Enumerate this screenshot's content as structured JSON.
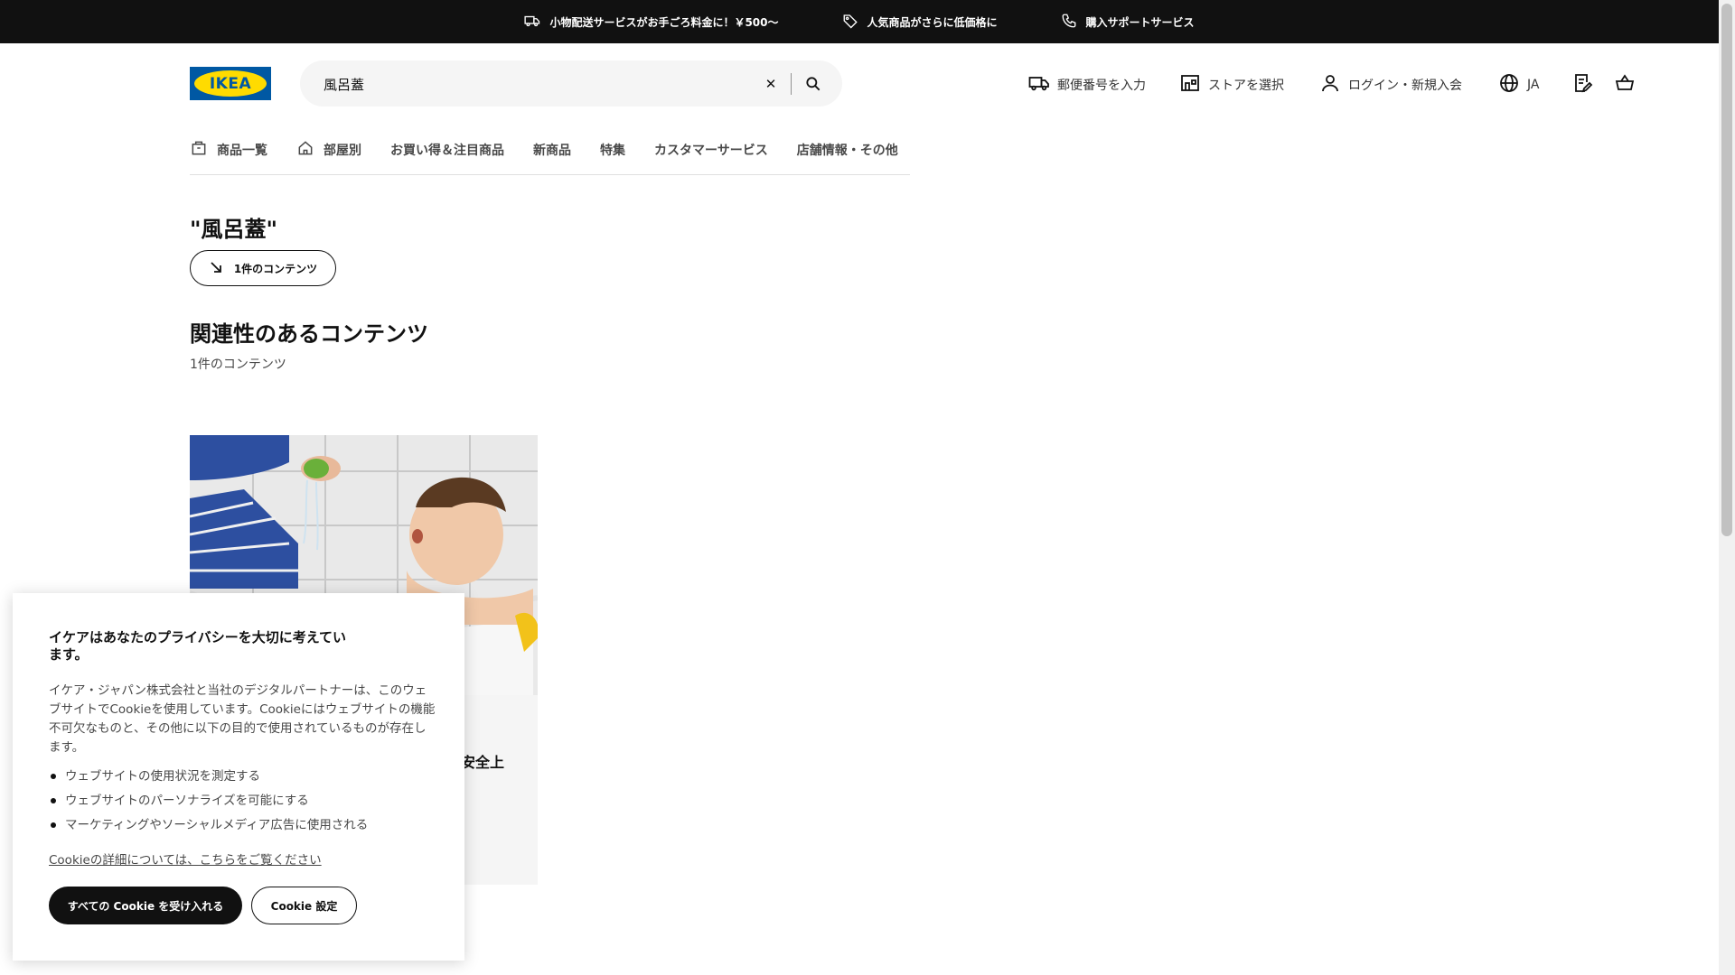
{
  "announcements": [
    {
      "icon": "truck-icon",
      "text": "小物配送サービスがお手ごろ料金に！￥500〜"
    },
    {
      "icon": "price-tag-icon",
      "text": "人気商品がさらに低価格に"
    },
    {
      "icon": "phone-icon",
      "text": "購入サポートサービス"
    }
  ],
  "logo": {
    "text": "IKEA"
  },
  "search": {
    "value": "風呂蓋"
  },
  "header_links": {
    "postcode": "郵便番号を入力",
    "store": "ストアを選択",
    "login": "ログイン・新規入会",
    "language": "JA"
  },
  "nav": [
    {
      "label": "商品一覧",
      "icon": "product-box-icon"
    },
    {
      "label": "部屋別",
      "icon": "house-icon"
    },
    {
      "label": "お買い得＆注目商品"
    },
    {
      "label": "新商品"
    },
    {
      "label": "特集"
    },
    {
      "label": "カスタマーサービス"
    },
    {
      "label": "店舗情報・その他"
    }
  ],
  "results": {
    "query": "\"風呂蓋\"",
    "pill_label": "1件のコンテンツ",
    "section_title": "関連性のあるコンテンツ",
    "section_count": "1件のコンテンツ",
    "card_title_visible": "安全上"
  },
  "cookie": {
    "title": "イケアはあなたのプライバシーを大切に考えています。",
    "body": "イケア・ジャパン株式会社と当社のデジタルパートナーは、このウェブサイトでCookieを使用しています。Cookieにはウェブサイトの機能不可欠なものと、その他に以下の目的で使用されているものが存在します。",
    "bullets": [
      "ウェブサイトの使用状況を測定する",
      "ウェブサイトのパーソナライズを可能にする",
      "マーケティングやソーシャルメディア広告に使用される"
    ],
    "link": "Cookieの詳細については、こちらをご覧ください",
    "accept_label": "すべての Cookie を受け入れる",
    "settings_label": "Cookie 設定"
  },
  "colors": {
    "topbar": "#111111",
    "ikea_blue": "#0058a3",
    "ikea_yellow": "#ffdb00",
    "search_bg": "#f5f5f5"
  }
}
